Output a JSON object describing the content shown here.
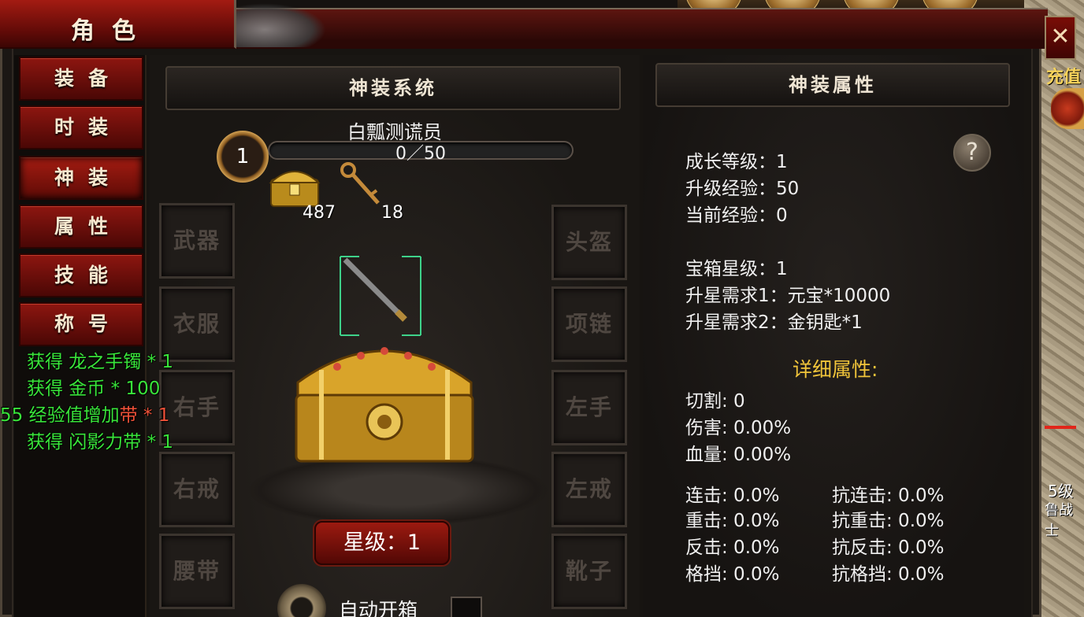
{
  "window": {
    "title": "角色",
    "close_label": "✕"
  },
  "sidebar": {
    "items": [
      {
        "label": "装备"
      },
      {
        "label": "时装"
      },
      {
        "label": "神装",
        "active": true
      },
      {
        "label": "属性"
      },
      {
        "label": "技能"
      },
      {
        "label": "称号"
      }
    ]
  },
  "divine_system": {
    "header": "神装系统",
    "player_name": "白瓢测谎员",
    "level": "1",
    "exp_text": "0／50",
    "exp_progress": 0,
    "chest_count": "487",
    "key_count": "18",
    "slots_left": [
      "武器",
      "衣服",
      "右手",
      "右戒",
      "腰带"
    ],
    "slots_right": [
      "头盔",
      "项链",
      "左手",
      "左戒",
      "靴子"
    ],
    "star_button": "星级：1",
    "auto_open_label": "自动开箱"
  },
  "attributes": {
    "header": "神装属性",
    "help_label": "?",
    "growth_level": "成长等级：1",
    "upgrade_exp": "升级经验：50",
    "current_exp": "当前经验：0",
    "chest_star": "宝箱星级：1",
    "star_req1": "升星需求1：元宝*10000",
    "star_req2": "升星需求2：金钥匙*1",
    "detail_title": "详细属性:",
    "cut": "切割:  0",
    "damage": "伤害:  0.00%",
    "hp": "血量:  0.00%",
    "combo": "连击:  0.0%",
    "anti_combo": "抗连击:  0.0%",
    "heavy": "重击:  0.0%",
    "anti_heavy": "抗重击:  0.0%",
    "counter": "反击:  0.0%",
    "anti_counter": "抗反击:  0.0%",
    "block": "格挡:  0.0%",
    "anti_block": "抗格挡:  0.0%"
  },
  "log": [
    {
      "text": "获得 龙之手镯 * 1"
    },
    {
      "text": "获得 金币 * 100"
    },
    {
      "prefix": "55 经验值增加",
      "suffix": "带 * 1"
    },
    {
      "text": "获得 闪影力带 * 1"
    }
  ],
  "hud": {
    "recharge": "充值",
    "mob_level": "5级",
    "mob_name": "鲁战士"
  },
  "colors": {
    "log_green": "#39e43a",
    "log_red": "#f05138",
    "detail_gold": "#f0c43a",
    "button_red": "#9c1a10"
  }
}
